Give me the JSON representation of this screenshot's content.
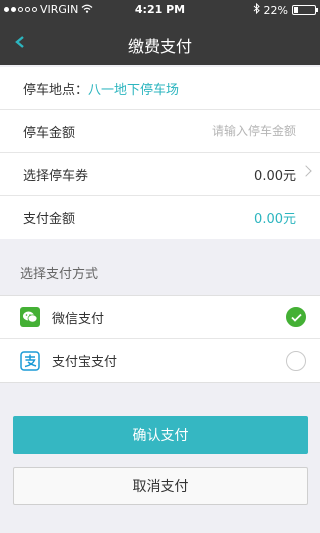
{
  "status_bar": {
    "carrier": "VIRGIN",
    "time": "4:21 PM",
    "battery_percent": "22%",
    "battery_level": 0.22
  },
  "nav": {
    "title": "缴费支付"
  },
  "parking": {
    "location_label": "停车地点：",
    "location_value": "八一地下停车场",
    "amount_label": "停车金额",
    "amount_placeholder": "请输入停车金额",
    "coupon_label": "选择停车券",
    "coupon_value": "0.00元",
    "pay_amount_label": "支付金额",
    "pay_amount_value": "0.00元"
  },
  "payment": {
    "section_title": "选择支付方式",
    "methods": [
      {
        "label": "微信支付",
        "icon": "wechat-icon",
        "selected": true
      },
      {
        "label": "支付宝支付",
        "icon": "alipay-icon",
        "selected": false
      }
    ]
  },
  "buttons": {
    "confirm": "确认支付",
    "cancel": "取消支付"
  },
  "colors": {
    "accent": "#35b7c2",
    "wechat_green": "#44b035",
    "header_bg": "#3a3a3a"
  }
}
